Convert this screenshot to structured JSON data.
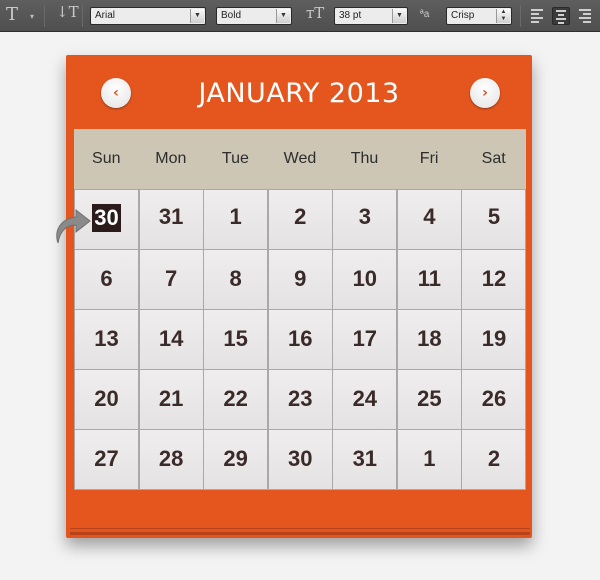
{
  "toolbar": {
    "font_family": "Arial",
    "font_style": "Bold",
    "font_size": "38 pt",
    "antialias_icon_text": "ªa",
    "antialias": "Crisp"
  },
  "calendar": {
    "title": "JANUARY 2013",
    "prev_symbol": "‹",
    "next_symbol": "›",
    "accent_color": "#e3551f",
    "weekdays": [
      "Sun",
      "Mon",
      "Tue",
      "Wed",
      "Thu",
      "Fri",
      "Sat"
    ],
    "weeks": [
      [
        "30",
        "31",
        "1",
        "2",
        "3",
        "4",
        "5"
      ],
      [
        "6",
        "7",
        "8",
        "9",
        "10",
        "11",
        "12"
      ],
      [
        "13",
        "14",
        "15",
        "16",
        "17",
        "18",
        "19"
      ],
      [
        "20",
        "21",
        "22",
        "23",
        "24",
        "25",
        "26"
      ],
      [
        "27",
        "28",
        "29",
        "30",
        "31",
        "1",
        "2"
      ]
    ],
    "selected": "30"
  }
}
